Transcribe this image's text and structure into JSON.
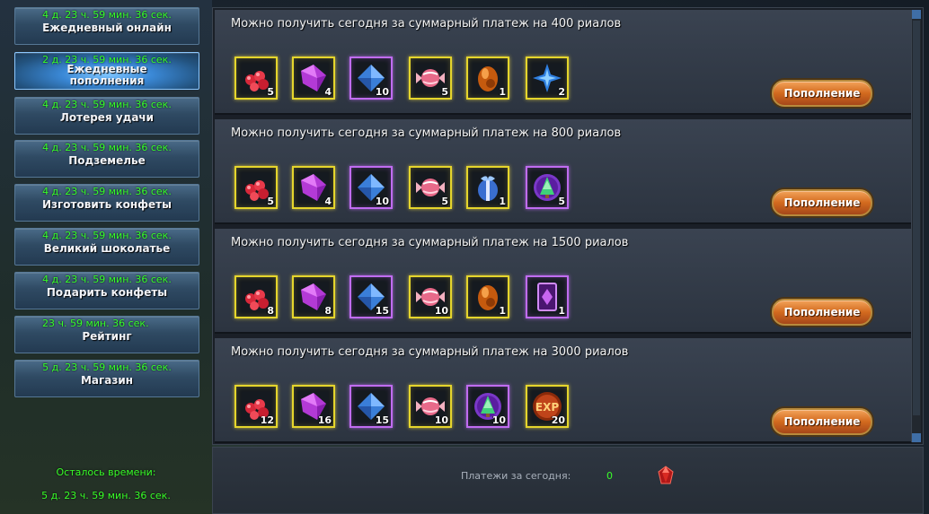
{
  "sidebar": {
    "items": [
      {
        "timer": "4 д. 23 ч. 59 мин. 36 сек.",
        "label": "Ежедневный онлайн"
      },
      {
        "timer": "2 д. 23 ч. 59 мин. 36 сек.",
        "label": "Ежедневные пополнения"
      },
      {
        "timer": "4 д. 23 ч. 59 мин. 36 сек.",
        "label": "Лотерея удачи"
      },
      {
        "timer": "4 д. 23 ч. 59 мин. 36 сек.",
        "label": "Подземелье"
      },
      {
        "timer": "4 д. 23 ч. 59 мин. 36 сек.",
        "label": "Изготовить конфеты"
      },
      {
        "timer": "4 д. 23 ч. 59 мин. 36 сек.",
        "label": "Великий шоколатье"
      },
      {
        "timer": "4 д. 23 ч. 59 мин. 36 сек.",
        "label": "Подарить конфеты"
      },
      {
        "timer": "23 ч. 59 мин. 36 сек.",
        "label": "Рейтинг"
      },
      {
        "timer": "5 д. 23 ч. 59 мин. 36 сек.",
        "label": "Магазин"
      }
    ],
    "remaining_label": "Осталось времени:",
    "remaining_value": "5 д. 23 ч. 59 мин. 36 сек."
  },
  "tiers": [
    {
      "title": "Можно получить сегодня за суммарный платеж на 400 риалов",
      "button": "Пополнение",
      "rewards": [
        {
          "icon": "red-berries-icon",
          "qty": "5",
          "frame": "gold"
        },
        {
          "icon": "purple-crystal-icon",
          "qty": "4",
          "frame": "gold"
        },
        {
          "icon": "blue-crystal-icon",
          "qty": "10",
          "frame": "purple"
        },
        {
          "icon": "candy-icon",
          "qty": "5",
          "frame": "gold"
        },
        {
          "icon": "amber-stone-icon",
          "qty": "1",
          "frame": "gold"
        },
        {
          "icon": "blue-star-icon",
          "qty": "2",
          "frame": "gold"
        }
      ]
    },
    {
      "title": "Можно получить сегодня за суммарный платеж на 800 риалов",
      "button": "Пополнение",
      "rewards": [
        {
          "icon": "red-berries-icon",
          "qty": "5",
          "frame": "gold"
        },
        {
          "icon": "purple-crystal-icon",
          "qty": "4",
          "frame": "gold"
        },
        {
          "icon": "blue-crystal-icon",
          "qty": "10",
          "frame": "purple"
        },
        {
          "icon": "candy-icon",
          "qty": "5",
          "frame": "gold"
        },
        {
          "icon": "gift-egg-icon",
          "qty": "1",
          "frame": "gold"
        },
        {
          "icon": "tree-orb-icon",
          "qty": "5",
          "frame": "purple"
        }
      ]
    },
    {
      "title": "Можно получить сегодня за суммарный платеж на 1500 риалов",
      "button": "Пополнение",
      "rewards": [
        {
          "icon": "red-berries-icon",
          "qty": "8",
          "frame": "gold"
        },
        {
          "icon": "purple-crystal-icon",
          "qty": "8",
          "frame": "gold"
        },
        {
          "icon": "blue-crystal-icon",
          "qty": "15",
          "frame": "purple"
        },
        {
          "icon": "candy-icon",
          "qty": "10",
          "frame": "gold"
        },
        {
          "icon": "amber-stone-icon",
          "qty": "1",
          "frame": "gold"
        },
        {
          "icon": "purple-card-icon",
          "qty": "1",
          "frame": "purple"
        }
      ]
    },
    {
      "title": "Можно получить сегодня за суммарный платеж на 3000 риалов",
      "button": "Пополнение",
      "rewards": [
        {
          "icon": "red-berries-icon",
          "qty": "12",
          "frame": "gold"
        },
        {
          "icon": "purple-crystal-icon",
          "qty": "16",
          "frame": "gold"
        },
        {
          "icon": "blue-crystal-icon",
          "qty": "15",
          "frame": "purple"
        },
        {
          "icon": "candy-icon",
          "qty": "10",
          "frame": "gold"
        },
        {
          "icon": "tree-orb-icon",
          "qty": "10",
          "frame": "purple"
        },
        {
          "icon": "exp-orb-icon",
          "qty": "20",
          "frame": "gold"
        }
      ]
    }
  ],
  "footer": {
    "payments_label": "Платежи за сегодня:",
    "payments_value": "0",
    "currency_icon": "red-gem-icon"
  },
  "colors": {
    "timer": "#36ff2a",
    "gold_frame": "#e5d52c",
    "purple_frame": "#c06cf0",
    "button": "#d26a1e"
  }
}
